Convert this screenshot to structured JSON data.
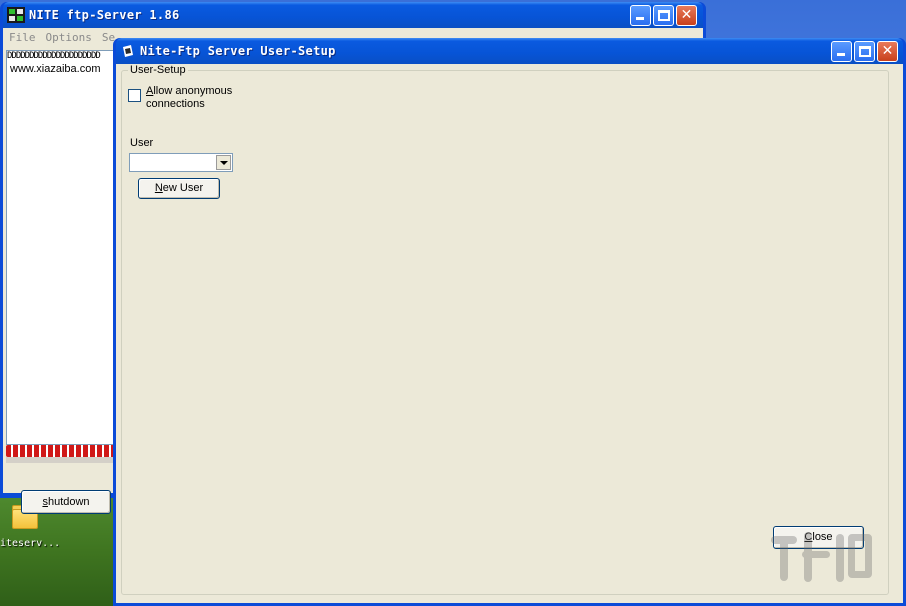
{
  "desktop": {
    "icon_label": "iteserv..."
  },
  "bg_window": {
    "title": "NITE ftp-Server 1.86",
    "menu": [
      "File",
      "Options",
      "Se"
    ],
    "log_chars": "DDDDDDDDDDDDDDDDDDDDD",
    "log_lines": [
      "www.xiazaiba.com"
    ],
    "shutdown_label": "shutdown"
  },
  "dialog": {
    "title": "Nite-Ftp Server User-Setup",
    "group_label": "User-Setup",
    "checkbox_label": "Allow anonymous connections",
    "checkbox_checked": false,
    "user_label": "User",
    "user_select_value": "",
    "new_user_label": "New User",
    "close_label": "Close"
  }
}
